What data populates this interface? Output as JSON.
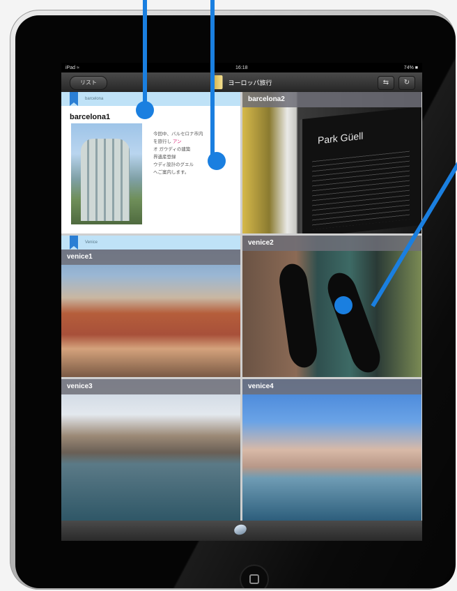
{
  "statusbar": {
    "left": "iPad ≈",
    "time": "16:18",
    "battery": "74% ■"
  },
  "navbar": {
    "back_label": "リスト",
    "title": "ヨーロッパ旅行",
    "icon_share": "⇆",
    "icon_refresh": "↻"
  },
  "sections": {
    "barcelona": "barcelona",
    "venice": "Venice"
  },
  "cells": [
    {
      "title": "barcelona1",
      "text_lines": [
        "今回中、バルセロナ市内",
        "を旅行し",
        "オ ガウディの建築",
        "界遺産登録",
        "ウディ設計のグエル",
        "へご案内します。"
      ],
      "highlight": "アン"
    },
    {
      "title": "barcelona2",
      "sign_text": "Park Güell"
    },
    {
      "title": "venice1"
    },
    {
      "title": "venice2"
    },
    {
      "title": "venice3"
    },
    {
      "title": "venice4"
    }
  ],
  "colors": {
    "accent": "#1a7fe0",
    "section_strip": "#bfe2f7",
    "bookmark": "#2b7fd4"
  }
}
